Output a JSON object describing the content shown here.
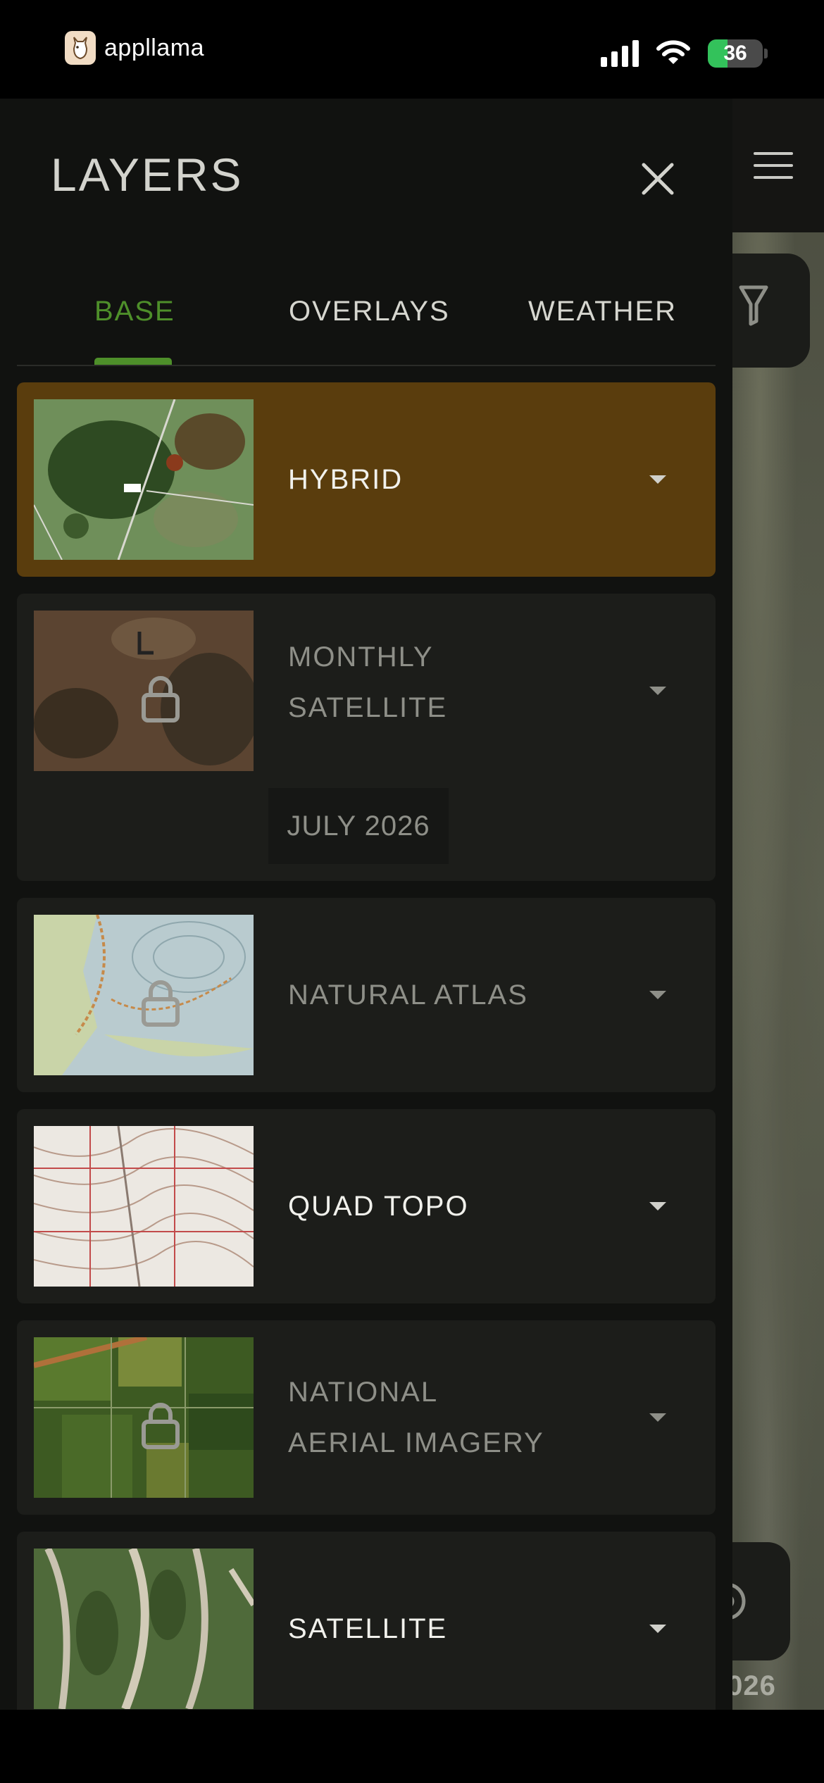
{
  "status_bar": {
    "app_name": "appllama",
    "battery_level": "36",
    "icons": [
      "app-logo-icon",
      "signal-icon",
      "wifi-icon",
      "battery-icon"
    ]
  },
  "panel": {
    "title": "LAYERS",
    "close_icon": "close-icon"
  },
  "tabs": [
    {
      "label": "BASE",
      "active": true
    },
    {
      "label": "OVERLAYS",
      "active": false
    },
    {
      "label": "WEATHER",
      "active": false
    }
  ],
  "layers": [
    {
      "name": "HYBRID",
      "selected": true,
      "locked": false
    },
    {
      "name": "MONTHLY SATELLITE",
      "selected": false,
      "locked": true,
      "date": "JULY 2026"
    },
    {
      "name": "NATURAL ATLAS",
      "selected": false,
      "locked": true
    },
    {
      "name": "QUAD TOPO",
      "selected": false,
      "locked": false
    },
    {
      "name": "NATIONAL AERIAL IMAGERY",
      "selected": false,
      "locked": true
    },
    {
      "name": "SATELLITE",
      "selected": false,
      "locked": false
    }
  ],
  "layer_labels": {
    "hybrid": "HYBRID",
    "monthly_line1": "MONTHLY",
    "monthly_line2": "SATELLITE",
    "monthly_date": "JULY 2026",
    "natural_atlas": "NATURAL ATLAS",
    "quad_topo": "QUAD TOPO",
    "naip_line1": "NATIONAL",
    "naip_line2": "AERIAL IMAGERY",
    "satellite": "SATELLITE"
  },
  "map": {
    "year_text": ".026",
    "icons": [
      "menu-icon",
      "filter-icon",
      "compass-icon"
    ]
  },
  "colors": {
    "accent_green": "#4e8f2a",
    "selected_card": "#5a3d0d",
    "panel_bg": "#111210",
    "card_bg": "#1c1d1a"
  }
}
